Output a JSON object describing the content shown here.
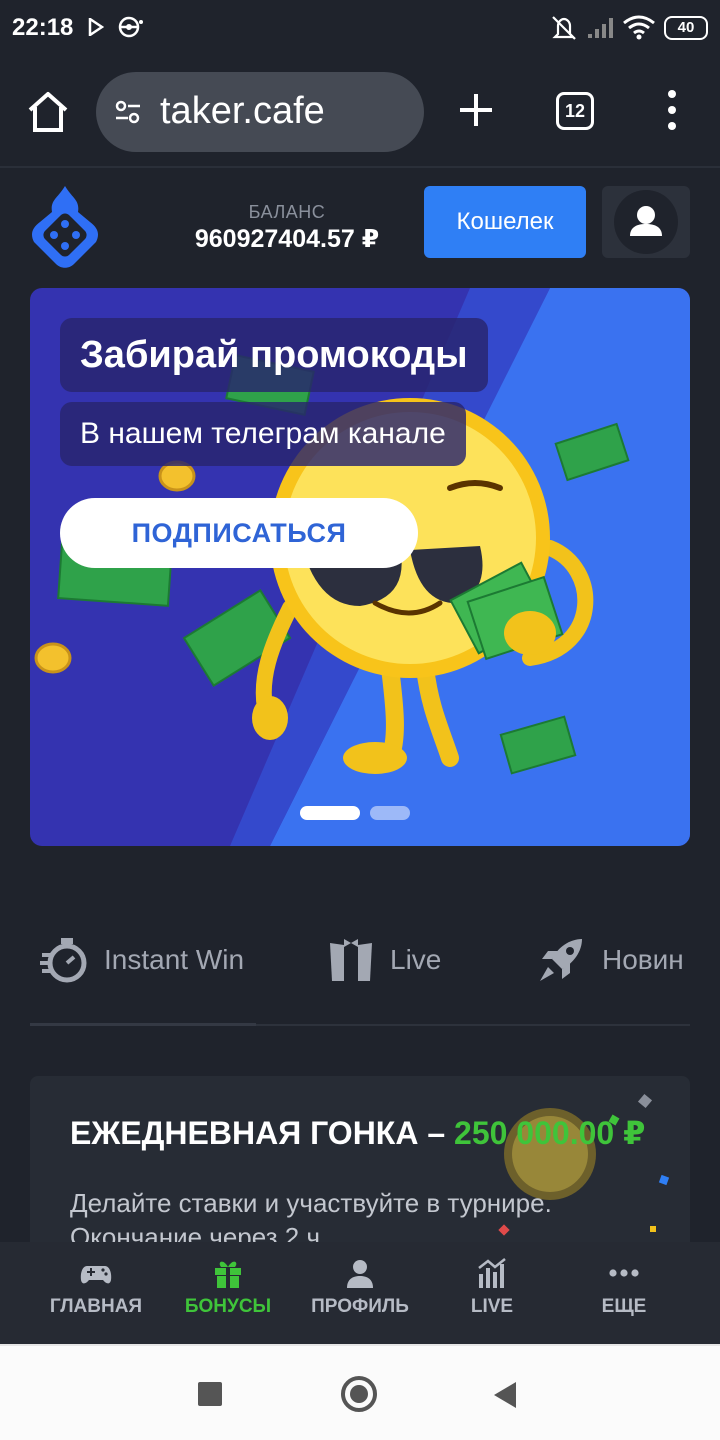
{
  "status_bar": {
    "time": "22:18",
    "battery": "40",
    "icons": [
      "play-icon",
      "pokeball-icon",
      "mute-icon",
      "signal-icon",
      "wifi-icon",
      "battery-icon"
    ]
  },
  "browser": {
    "url": "taker.cafe",
    "tab_count": "12",
    "icons": [
      "home-icon",
      "site-settings-icon",
      "plus-icon",
      "tabs-icon",
      "more-icon"
    ]
  },
  "header": {
    "balance_label": "БАЛАНС",
    "balance_value": "960927404.57 ₽",
    "wallet_button": "Кошелек",
    "colors": {
      "accent": "#2f7ff5"
    }
  },
  "banner": {
    "title": "Забирай промокоды",
    "subtitle": "В нашем телеграм канале",
    "cta": "ПОДПИСАТЬСЯ",
    "slides_total": 2,
    "active_slide": 1
  },
  "categories": [
    {
      "label": "Instant Win",
      "icon": "timer-icon"
    },
    {
      "label": "Live",
      "icon": "tuxedo-icon"
    },
    {
      "label": "Новин",
      "icon": "rocket-icon"
    }
  ],
  "race": {
    "title": "ЕЖЕДНЕВНАЯ ГОНКА – ",
    "amount": "250 000.00 ₽",
    "description": "Делайте ставки и участвуйте в турнире. Окончание через 2 ч",
    "colors": {
      "amount": "#3fc43a"
    }
  },
  "bottom_nav": [
    {
      "label": "ГЛАВНАЯ",
      "icon": "gamepad-icon"
    },
    {
      "label": "БОНУСЫ",
      "icon": "gift-icon",
      "active": true
    },
    {
      "label": "ПРОФИЛЬ",
      "icon": "user-icon"
    },
    {
      "label": "LIVE",
      "icon": "chart-icon"
    },
    {
      "label": "ЕЩЕ",
      "icon": "dots-icon"
    }
  ]
}
